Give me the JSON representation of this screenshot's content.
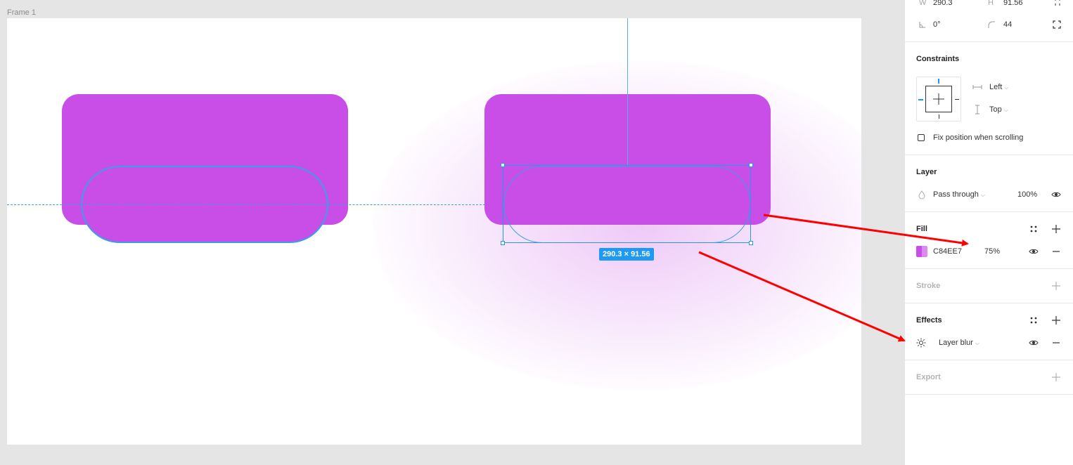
{
  "canvas": {
    "frame_label": "Frame 1",
    "selection_size": "290.3 × 91.56",
    "fill_color": "#c84ee7",
    "selection_color": "#1e9af3"
  },
  "panel": {
    "transform": {
      "w_label": "W",
      "w_value": "290.3",
      "h_label": "H",
      "h_value": "91.56",
      "rotation_value": "0°",
      "radius_value": "44"
    },
    "constraints": {
      "title": "Constraints",
      "horizontal": "Left",
      "vertical": "Top",
      "fix_position_label": "Fix position when scrolling"
    },
    "layer": {
      "title": "Layer",
      "blend_mode": "Pass through",
      "opacity": "100%"
    },
    "fill": {
      "title": "Fill",
      "hex": "C84EE7",
      "opacity": "75%"
    },
    "stroke": {
      "title": "Stroke"
    },
    "effects": {
      "title": "Effects",
      "effect_name": "Layer blur"
    },
    "export": {
      "title": "Export"
    }
  },
  "icons": {
    "lock": "lock-icon",
    "rotation": "rotation-icon",
    "radius": "corner-radius-icon",
    "resize": "independent-corners-icon",
    "styles": "style-grid-icon",
    "add": "plus-icon",
    "remove": "minus-icon",
    "visibility": "eye-icon",
    "blur": "sun-blur-icon",
    "chevron": "chevron-down-icon"
  }
}
